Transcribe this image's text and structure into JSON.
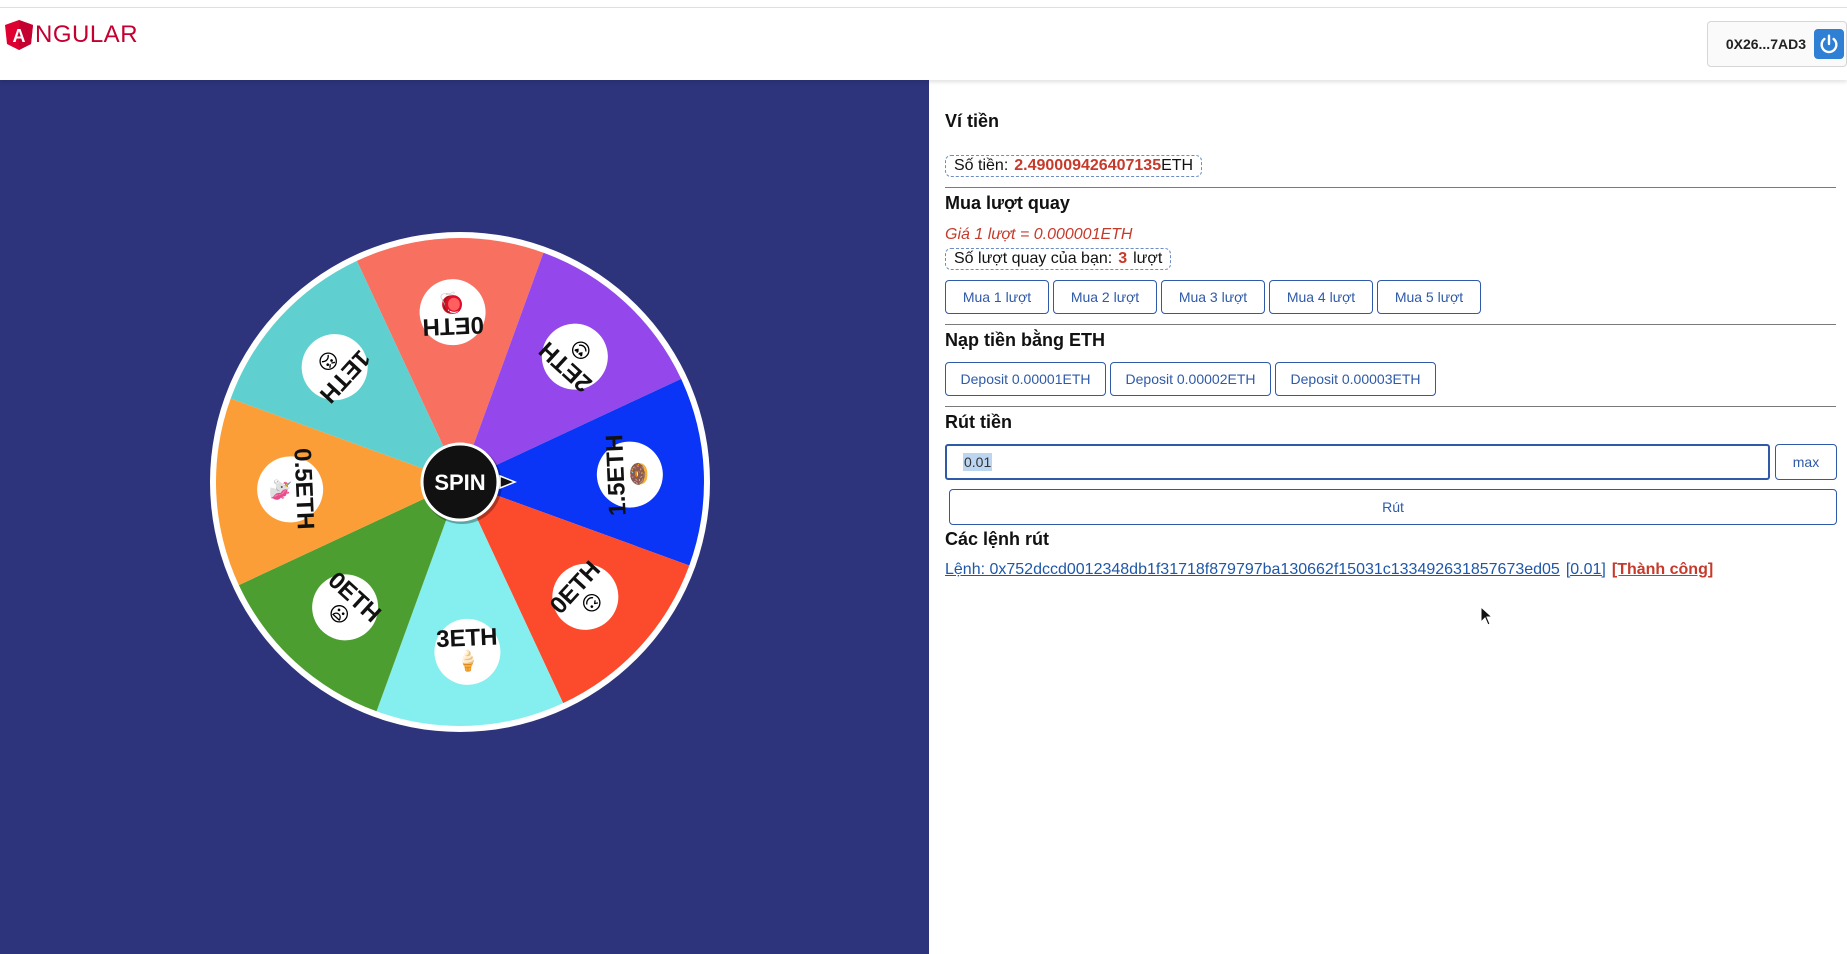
{
  "header": {
    "logo_text": "NGULAR",
    "logo_letter": "A",
    "wallet_address": "0X26...7AD3",
    "icons": {
      "logo": "angular-logo-icon",
      "power": "power-icon"
    }
  },
  "wheel": {
    "center_label": "SPIN",
    "segments": [
      {
        "label": "0ETH",
        "color": "#f8705f",
        "emoji": "🪀"
      },
      {
        "label": "2ETH",
        "color": "#9447ea",
        "emoji": "😍"
      },
      {
        "label": "1.5ETH",
        "color": "#0a34f6",
        "emoji": "🍩"
      },
      {
        "label": "0ETH",
        "color": "#fc4a2d",
        "emoji": "🙃"
      },
      {
        "label": "3ETH",
        "color": "#85eeee",
        "emoji": "🍦"
      },
      {
        "label": "0ETH",
        "color": "#4c9e30",
        "emoji": "😦"
      },
      {
        "label": "0.5ETH",
        "color": "#fc9e37",
        "emoji": "🦄"
      },
      {
        "label": "1ETH",
        "color": "#5fcfcf",
        "emoji": "😠"
      }
    ],
    "colors": {
      "background": "#2d347c",
      "rim": "#ffffff",
      "hub": "#111111"
    }
  },
  "wallet_section": {
    "title": "Ví tiền",
    "balance_label": "Số tiền:",
    "balance_value": "2.490009426407135",
    "balance_unit": "ETH"
  },
  "buy_section": {
    "title": "Mua lượt quay",
    "price_text": "Giá 1 lượt = 0.000001ETH",
    "spins_label": "Số lượt quay của bạn:",
    "spins_value": "3",
    "spins_unit": "lượt",
    "buttons": [
      "Mua 1 lượt",
      "Mua 2 lượt",
      "Mua 3 lượt",
      "Mua 4 lượt",
      "Mua 5 lượt"
    ]
  },
  "deposit_section": {
    "title": "Nạp tiền bằng ETH",
    "buttons": [
      "Deposit 0.00001ETH",
      "Deposit 0.00002ETH",
      "Deposit 0.00003ETH"
    ]
  },
  "withdraw_section": {
    "title": "Rút tiền",
    "input_value": "0.01",
    "max_label": "max",
    "submit_label": "Rút"
  },
  "orders_section": {
    "title": "Các lệnh rút",
    "orders": [
      {
        "text": "Lệnh: 0x752dccd0012348db1f31718f879797ba130662f15031c133492631857673ed05",
        "amount": "[0.01]",
        "status": "[Thành công]"
      }
    ]
  }
}
